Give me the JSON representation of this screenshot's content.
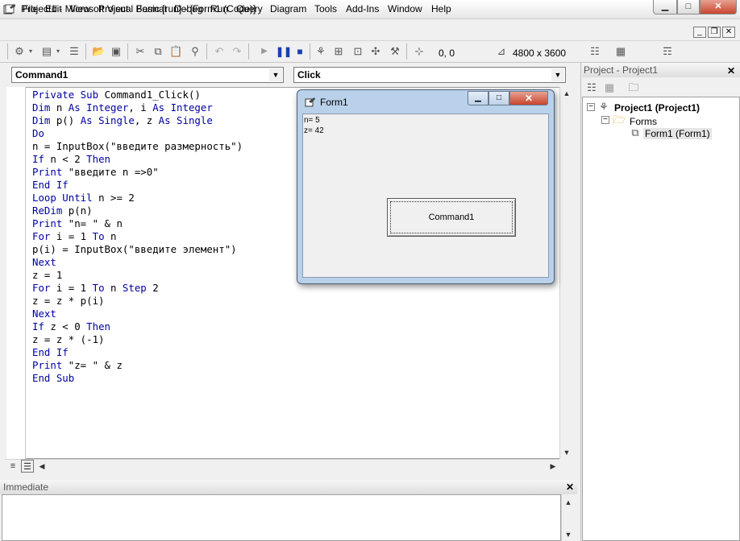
{
  "window": {
    "title": "Project1 - Microsoft Visual Basic [run] - [Form1 (Code)]",
    "min_glyph": "▭",
    "max_glyph": "▢",
    "close_glyph": "✕"
  },
  "menu": {
    "items": [
      {
        "label": "File",
        "u": "F",
        "rest": "ile"
      },
      {
        "label": "Edit",
        "u": "E",
        "rest": "dit"
      },
      {
        "label": "View",
        "u": "V",
        "rest": "iew"
      },
      {
        "label": "Project",
        "u": "P",
        "rest": "roject"
      },
      {
        "label": "Format",
        "u": "o",
        "pre": "F",
        "rest": "rmat"
      },
      {
        "label": "Debug",
        "u": "D",
        "rest": "ebug"
      },
      {
        "label": "Run",
        "u": "R",
        "rest": "un"
      },
      {
        "label": "Query",
        "u": "Q",
        "rest": "uery"
      },
      {
        "label": "Diagram",
        "u": "i",
        "pre": "D",
        "rest": "agram"
      },
      {
        "label": "Tools",
        "u": "T",
        "rest": "ools"
      },
      {
        "label": "Add-Ins",
        "u": "A",
        "rest": "dd-Ins"
      },
      {
        "label": "Window",
        "u": "W",
        "rest": "indow"
      },
      {
        "label": "Help",
        "u": "H",
        "rest": "elp"
      }
    ],
    "mdi_min": "_",
    "mdi_restore": "▫",
    "mdi_close": "✕"
  },
  "toolbar": {
    "position": "0, 0",
    "size": "4800 x 3600",
    "icons": [
      "add-project-icon",
      "add-form-icon",
      "menu-editor-icon",
      "open-icon",
      "save-icon",
      "cut-icon",
      "copy-icon",
      "paste-icon",
      "find-icon",
      "undo-icon",
      "redo-icon",
      "start-icon",
      "break-icon",
      "end-icon",
      "project-explorer-icon",
      "properties-icon",
      "form-layout-icon",
      "object-browser-icon",
      "toolbox-icon"
    ]
  },
  "code": {
    "object_combo": "Command1",
    "proc_combo": "Click",
    "lines": [
      [
        {
          "t": "Private Sub ",
          "k": true
        },
        {
          "t": "Command1_Click()"
        }
      ],
      [
        {
          "t": "Dim ",
          "k": true
        },
        {
          "t": "n "
        },
        {
          "t": "As Integer",
          "k": true
        },
        {
          "t": ", i "
        },
        {
          "t": "As Integer",
          "k": true
        }
      ],
      [
        {
          "t": "Dim ",
          "k": true
        },
        {
          "t": "p() "
        },
        {
          "t": "As Single",
          "k": true
        },
        {
          "t": ", z "
        },
        {
          "t": "As Single",
          "k": true
        }
      ],
      [
        {
          "t": "Do",
          "k": true
        }
      ],
      [
        {
          "t": "n = InputBox(\"введите размерность\")"
        }
      ],
      [
        {
          "t": "If ",
          "k": true
        },
        {
          "t": "n < 2 "
        },
        {
          "t": "Then",
          "k": true
        }
      ],
      [
        {
          "t": "Print ",
          "k": true
        },
        {
          "t": "\"введите n =>0\""
        }
      ],
      [
        {
          "t": "End If",
          "k": true
        }
      ],
      [
        {
          "t": "Loop Until ",
          "k": true
        },
        {
          "t": "n >= 2"
        }
      ],
      [
        {
          "t": "ReDim ",
          "k": true
        },
        {
          "t": "p(n)"
        }
      ],
      [
        {
          "t": "Print ",
          "k": true
        },
        {
          "t": "\"n= \" & n"
        }
      ],
      [
        {
          "t": "For ",
          "k": true
        },
        {
          "t": "i = 1 "
        },
        {
          "t": "To ",
          "k": true
        },
        {
          "t": "n"
        }
      ],
      [
        {
          "t": "p(i) = InputBox(\"введите элемент\")"
        }
      ],
      [
        {
          "t": "Next",
          "k": true
        }
      ],
      [
        {
          "t": "z = 1"
        }
      ],
      [
        {
          "t": "For ",
          "k": true
        },
        {
          "t": "i = 1 "
        },
        {
          "t": "To ",
          "k": true
        },
        {
          "t": "n "
        },
        {
          "t": "Step ",
          "k": true
        },
        {
          "t": "2"
        }
      ],
      [
        {
          "t": "z = z * p(i)"
        }
      ],
      [
        {
          "t": "Next",
          "k": true
        }
      ],
      [
        {
          "t": "If ",
          "k": true
        },
        {
          "t": "z < 0 "
        },
        {
          "t": "Then",
          "k": true
        }
      ],
      [
        {
          "t": "z = z * (-1)"
        }
      ],
      [
        {
          "t": "End If",
          "k": true
        }
      ],
      [
        {
          "t": "Print ",
          "k": true
        },
        {
          "t": "\"z= \" & z"
        }
      ],
      [
        {
          "t": "End Sub",
          "k": true
        }
      ]
    ]
  },
  "immediate": {
    "title": "Immediate",
    "close": "✕"
  },
  "project": {
    "title": "Project - Project1",
    "close": "✕",
    "root": "Project1 (Project1)",
    "folder": "Forms",
    "form": "Form1 (Form1)",
    "expander": "−"
  },
  "form1": {
    "title": "Form1",
    "output": [
      "n= 5",
      "z= 42"
    ],
    "button": "Command1"
  },
  "colors": {
    "keyword": "#0000a0",
    "form_frame": "#b9d1ea",
    "close_red": "#c7462f"
  }
}
